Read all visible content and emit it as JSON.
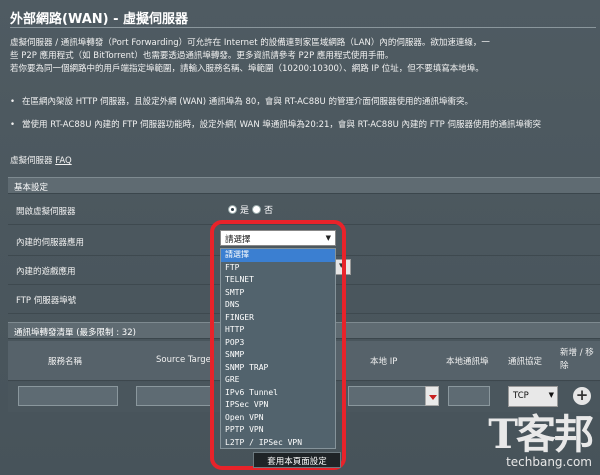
{
  "page": {
    "title": "外部網路(WAN) - 虛擬伺服器",
    "intro_lines": [
      "虛擬伺服器 / 通訊埠轉發（Port Forwarding）可允許在 Internet 的設備連到家區域網路（LAN）內的伺服器。欲加速連線，一",
      "些 P2P 應用程式（如 BitTorrent）也需要透過通訊埠轉發。更多資訊請參考 P2P 應用程式使用手冊。",
      "若你要為同一個網路中的用戶端指定埠範圍，請輸入服務名稱、埠範圍（10200:10300）、網路 IP 位址，但不要填寫本地埠。"
    ],
    "bullets": [
      "在區網內架設 HTTP 伺服器，且設定外網 (WAN) 通訊埠為 80，會與 RT-AC88U 的管理介面伺服器使用的通訊埠衝突。",
      "當使用 RT-AC88U 內建的 FTP 伺服器功能時，設定外網( WAN 埠通訊埠為20:21，會與 RT-AC88U 內建的 FTP 伺服器使用的通訊埠衝突"
    ],
    "faq_label": "虛擬伺服器",
    "faq_link": "FAQ"
  },
  "basic": {
    "header": "基本設定",
    "enable_label": "開啟虛擬伺服器",
    "yes": "是",
    "no": "否",
    "famous_server_label": "內建的伺服器應用",
    "famous_game_label": "內建的遊戲應用",
    "ftp_port_label": "FTP 伺服器埠號"
  },
  "dropdown": {
    "selected": "請選擇",
    "options": [
      "請選擇",
      "FTP",
      "TELNET",
      "SMTP",
      "DNS",
      "FINGER",
      "HTTP",
      "POP3",
      "SNMP",
      "SNMP TRAP",
      "GRE",
      "IPv6 Tunnel",
      "IPSec VPN",
      "Open VPN",
      "PPTP VPN",
      "L2TP / IPSec VPN"
    ]
  },
  "table": {
    "header": "通訊埠轉發清單 (最多限制 : 32)",
    "columns": [
      "服務名稱",
      "Source Target",
      "本地 IP",
      "本地通訊埠",
      "通訊協定",
      "新增 / 移除"
    ],
    "protocol_value": "TCP"
  },
  "apply_button": "套用本頁面設定",
  "watermark": {
    "big": "T客邦",
    "small": "techbang.com"
  }
}
